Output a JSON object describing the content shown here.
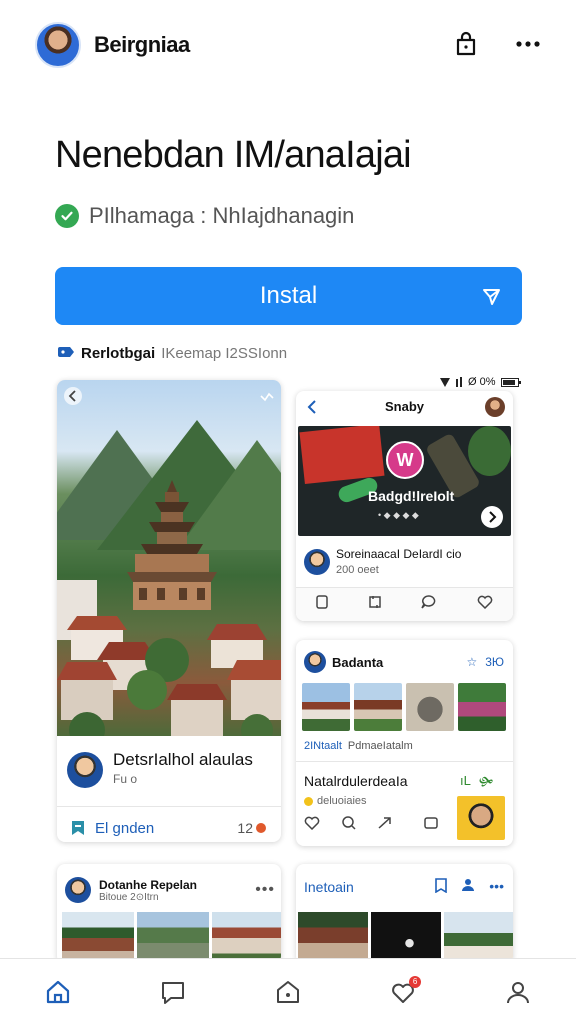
{
  "header": {
    "app_name": "Beirgniaa",
    "icons": [
      "profile-avatar",
      "notification-bag-icon",
      "more-dots-icon"
    ]
  },
  "title": "Nenebdan IM/anaIajai",
  "verified": {
    "icon": "check-circle-icon",
    "text": "PIlhamaga : NhIajdhanagin"
  },
  "install": {
    "label": "Instal",
    "icon": "send-arrow-icon",
    "color": "#1e88f5"
  },
  "meta": {
    "strong": "Rerlotbgai",
    "light": "IKeemap I2SSIonn"
  },
  "status_bar": {
    "text": "Ø 0%"
  },
  "cards": {
    "big": {
      "title": "DetsrIalhol alaulas",
      "sub": "Fu o",
      "footer_label": "El gnden",
      "footer_count": "12"
    },
    "shop": {
      "title": "Snaby",
      "product_name": "Badgd!lreIolt",
      "product_dots": "• ◆ ◆ ◆ ◆",
      "logo_glyph": "W",
      "seller": "SoreinaacaI DeIardI cio",
      "seller_meta": "200 oeet"
    },
    "gallery": {
      "title": "Badanta",
      "tools": [
        "☆",
        "3Ю"
      ],
      "caption_blue": "2INtaalt",
      "caption_muted": "PdmaeIatalm",
      "sub_title": "NatalrdulerdeaIa",
      "sub_meta": "deluoiaies",
      "sub_icons": [
        "ıL",
        "🙟"
      ]
    },
    "bottom_left": {
      "title": "Dotanhe Repelan",
      "sub": "Bitoue 2⊙Itrn"
    },
    "bottom_right": {
      "title": "Inetoain"
    }
  },
  "bottom_nav": {
    "items": [
      "home-icon",
      "chat-icon",
      "store-icon",
      "heart-icon",
      "profile-icon"
    ],
    "badge": "6"
  },
  "colors": {
    "accent": "#1e88f5",
    "link": "#1e5fb8",
    "verified": "#34a853",
    "badge": "#e53935"
  }
}
